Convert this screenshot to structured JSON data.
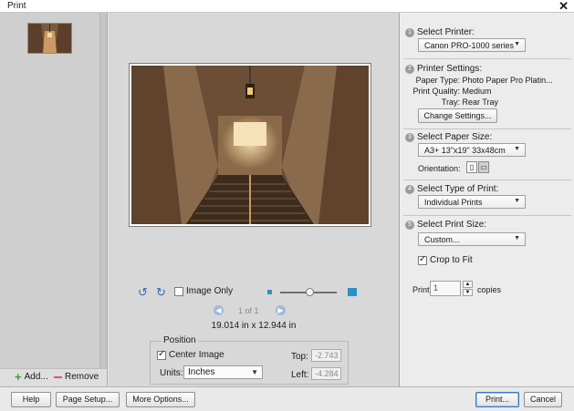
{
  "window": {
    "title": "Print",
    "close_glyph": "✕"
  },
  "thumbnails": {
    "add_label": "Add...",
    "remove_label": "Remove"
  },
  "preview": {
    "image_only_label": "Image Only",
    "page_indicator": "1 of 1",
    "dimensions": "19.014 in x 12.944 in",
    "zoom_level": 0.52
  },
  "position": {
    "legend": "Position",
    "center_image_label": "Center Image",
    "center_image_checked": true,
    "units_label": "Units:",
    "units_value": "Inches",
    "top_label": "Top:",
    "top_value": "-2.743",
    "left_label": "Left:",
    "left_value": "-4.284"
  },
  "settings": {
    "step1": {
      "num": "1",
      "label": "Select Printer:",
      "value": "Canon PRO-1000 series"
    },
    "step2": {
      "num": "2",
      "label": "Printer Settings:",
      "paper_type_label": "Paper Type:",
      "paper_type_value": "Photo Paper Pro Platin...",
      "print_quality_label": "Print Quality:",
      "print_quality_value": "Medium",
      "tray_label": "Tray:",
      "tray_value": "Rear Tray",
      "change_button": "Change Settings..."
    },
    "step3": {
      "num": "3",
      "label": "Select Paper Size:",
      "value": "A3+ 13\"x19\" 33x48cm",
      "orientation_label": "Orientation:"
    },
    "step4": {
      "num": "4",
      "label": "Select Type of Print:",
      "value": "Individual Prints"
    },
    "step5": {
      "num": "5",
      "label": "Select Print Size:",
      "value": "Custom...",
      "crop_label": "Crop to Fit",
      "crop_checked": true
    },
    "copies": {
      "print_label": "Print",
      "value": "1",
      "copies_label": "copies"
    }
  },
  "footer": {
    "help": "Help",
    "page_setup": "Page Setup...",
    "more_options": "More Options...",
    "print": "Print...",
    "cancel": "Cancel"
  },
  "icons": {
    "close": "close-icon",
    "add": "plus-icon",
    "remove": "minus-icon",
    "rotate_left": "rotate-left-icon",
    "rotate_right": "rotate-right-icon",
    "prev": "chevron-left-icon",
    "next": "chevron-right-icon",
    "dropdown": "chevron-down-icon"
  },
  "colors": {
    "accent": "#2f8fc8",
    "add_green": "#3b9b3b",
    "remove_pink": "#d85a74"
  }
}
